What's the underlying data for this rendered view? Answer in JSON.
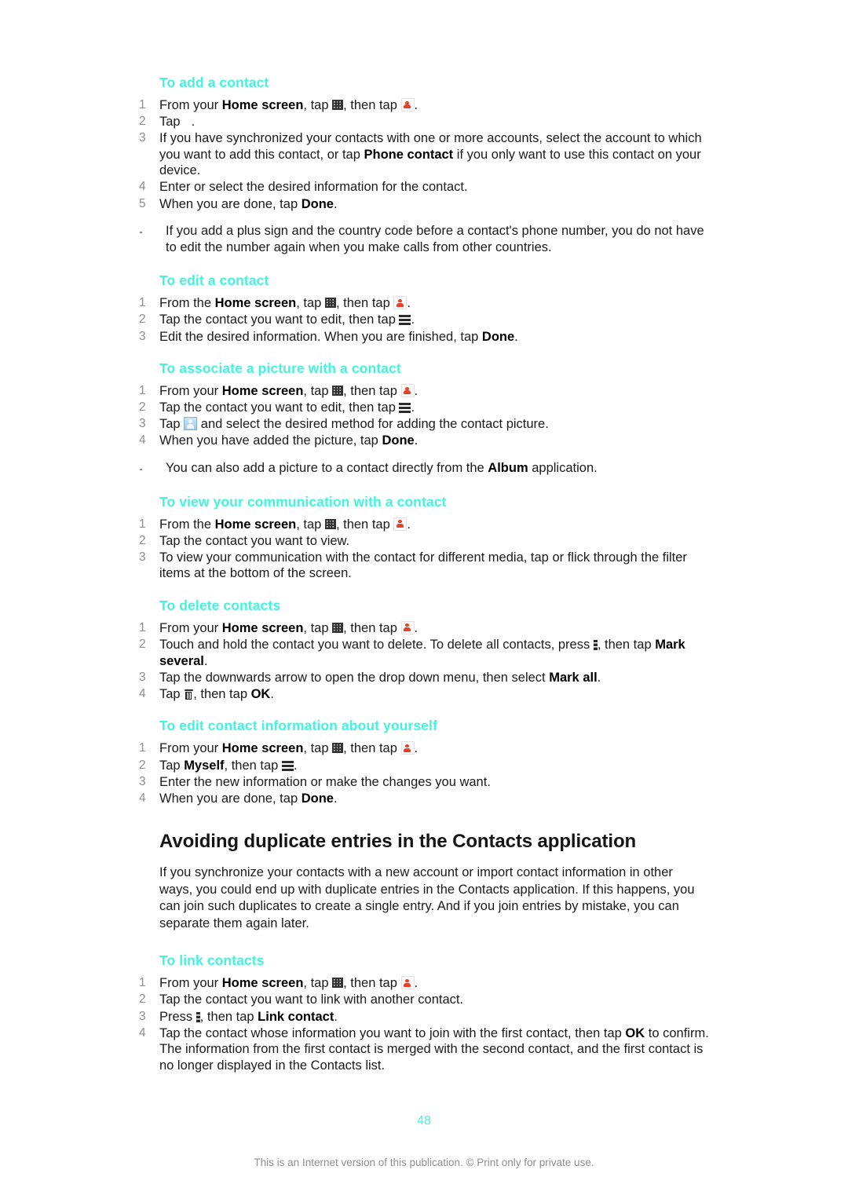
{
  "document": {
    "page_number": "48",
    "footer_note": "This is an Internet version of this publication. © Print only for private use.",
    "accent_color": "#3FF5DC"
  },
  "sections": {
    "add_contact": {
      "heading": "To add a contact",
      "steps": {
        "s1_a": "From your ",
        "s1_b": "Home screen",
        "s1_c": ", tap ",
        "s1_d": ", then tap ",
        "s1_e": ".",
        "s2_a": "Tap",
        "s2_b": ".",
        "s3_a": "If you have synchronized your contacts with one or more accounts, select the account to which you want to add this contact, or tap ",
        "s3_b": "Phone contact",
        "s3_c": " if you only want to use this contact on your device.",
        "s4": "Enter or select the desired information for the contact.",
        "s5_a": "When you are done, tap ",
        "s5_b": "Done",
        "s5_c": "."
      },
      "tip": "If you add a plus sign and the country code before a contact's phone number, you do not have to edit the number again when you make calls from other countries."
    },
    "edit_contact": {
      "heading": "To edit a contact",
      "steps": {
        "s1_a": "From the ",
        "s1_b": "Home screen",
        "s1_c": ", tap ",
        "s1_d": ", then tap ",
        "s1_e": ".",
        "s2_a": "Tap the contact you want to edit, then tap ",
        "s2_b": ".",
        "s3_a": "Edit the desired information. When you are finished, tap ",
        "s3_b": "Done",
        "s3_c": "."
      }
    },
    "associate_picture": {
      "heading": "To associate a picture with a contact",
      "steps": {
        "s1_a": "From your ",
        "s1_b": "Home screen",
        "s1_c": ", tap ",
        "s1_d": ", then tap ",
        "s1_e": ".",
        "s2_a": "Tap the contact you want to edit, then tap ",
        "s2_b": ".",
        "s3_a": "Tap ",
        "s3_b": " and select the desired method for adding the contact picture.",
        "s4_a": "When you have added the picture, tap ",
        "s4_b": "Done",
        "s4_c": "."
      },
      "tip_a": "You can also add a picture to a contact directly from the ",
      "tip_b": "Album",
      "tip_c": " application."
    },
    "view_communication": {
      "heading": "To view your communication with a contact",
      "steps": {
        "s1_a": "From the ",
        "s1_b": "Home screen",
        "s1_c": ", tap ",
        "s1_d": ", then tap ",
        "s1_e": ".",
        "s2": "Tap the contact you want to view.",
        "s3": "To view your communication with the contact for different media, tap or flick through the filter items at the bottom of the screen."
      }
    },
    "delete_contacts": {
      "heading": "To delete contacts",
      "steps": {
        "s1_a": "From your ",
        "s1_b": "Home screen",
        "s1_c": ", tap ",
        "s1_d": ", then tap ",
        "s1_e": ".",
        "s2_a": "Touch and hold the contact you want to delete. To delete all contacts, press ",
        "s2_b": ", then tap ",
        "s2_c": "Mark several",
        "s2_d": ".",
        "s3_a": "Tap the downwards arrow to open the drop down menu, then select ",
        "s3_b": "Mark all",
        "s3_c": ".",
        "s4_a": "Tap ",
        "s4_b": ", then tap ",
        "s4_c": "OK",
        "s4_d": "."
      }
    },
    "edit_yourself": {
      "heading": "To edit contact information about yourself",
      "steps": {
        "s1_a": "From your ",
        "s1_b": "Home screen",
        "s1_c": ", tap ",
        "s1_d": ", then tap ",
        "s1_e": ".",
        "s2_a": "Tap ",
        "s2_b": "Myself",
        "s2_c": ", then tap ",
        "s2_d": ".",
        "s3": "Enter the new information or make the changes you want.",
        "s4_a": "When you are done, tap ",
        "s4_b": "Done",
        "s4_c": "."
      }
    },
    "avoiding_duplicates": {
      "heading": "Avoiding duplicate entries in the Contacts application",
      "paragraph": "If you synchronize your contacts with a new account or import contact information in other ways, you could end up with duplicate entries in the Contacts application. If this happens, you can join such duplicates to create a single entry. And if you join entries by mistake, you can separate them again later."
    },
    "link_contacts": {
      "heading": "To link contacts",
      "steps": {
        "s1_a": "From your ",
        "s1_b": "Home screen",
        "s1_c": ", tap ",
        "s1_d": ", then tap ",
        "s1_e": ".",
        "s2": "Tap the contact you want to link with another contact.",
        "s3_a": "Press ",
        "s3_b": ", then tap ",
        "s3_c": "Link contact",
        "s3_d": ".",
        "s4_a": "Tap the contact whose information you want to join with the first contact, then tap ",
        "s4_b": "OK",
        "s4_c": " to confirm. The information from the first contact is merged with the second contact, and the first contact is no longer displayed in the Contacts list."
      }
    }
  }
}
